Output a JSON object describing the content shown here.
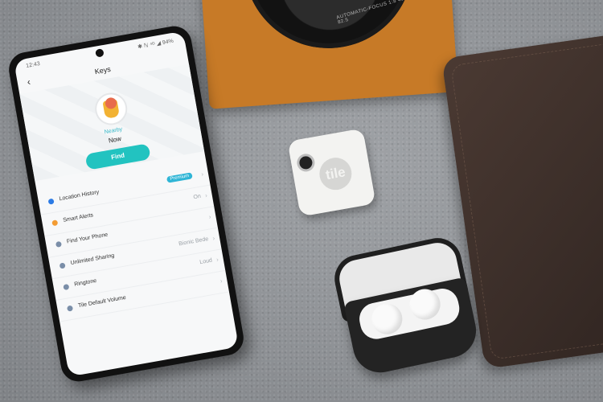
{
  "phone_app": {
    "status_time": "12:43",
    "status_right": "✱ ℕ ⁴ᴳ ◢ 94%",
    "back_icon": "chevron-left-icon",
    "title": "Keys",
    "nearby": "Nearby",
    "now": "Now",
    "find_label": "Find",
    "accent": "#22c3c0",
    "rows": [
      {
        "label": "Location History",
        "value": "",
        "badge": "Premium",
        "icon_color": "#2c7be5"
      },
      {
        "label": "Smart Alerts",
        "value": "On",
        "badge": "",
        "icon_color": "#f39c33"
      },
      {
        "label": "Find Your Phone",
        "value": "",
        "badge": "",
        "icon_color": "#7a8ea8"
      },
      {
        "label": "Unlimited Sharing",
        "value": "Bionic Bede",
        "badge": "",
        "icon_color": "#7a8ea8"
      },
      {
        "label": "Ringtone",
        "value": "Loud",
        "badge": "",
        "icon_color": "#7a8ea8"
      },
      {
        "label": "Tile Default Volume",
        "value": "",
        "badge": "",
        "icon_color": "#7a8ea8"
      }
    ]
  },
  "tile_tracker": {
    "logo": "tile"
  },
  "camera": {
    "lens_text": "AUTOMATIC-FOCUS 1:8 48 82.5"
  }
}
